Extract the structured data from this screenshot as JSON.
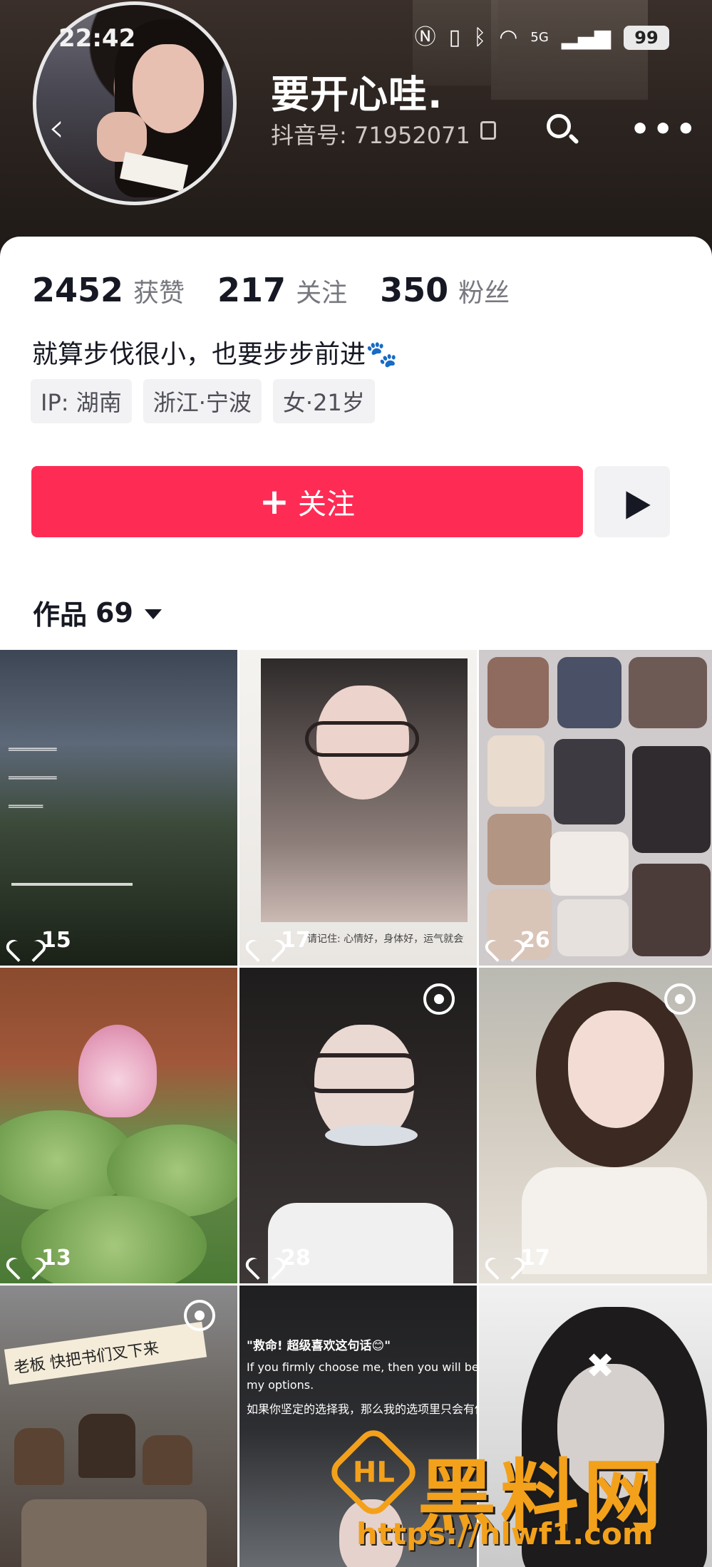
{
  "status_bar": {
    "time": "22:42",
    "battery": "99",
    "network": "5G"
  },
  "profile": {
    "username": "要开心哇.",
    "douyin_id": "抖音号: 71952071",
    "stats": [
      {
        "num": "2452",
        "label": "获赞"
      },
      {
        "num": "217",
        "label": "关注"
      },
      {
        "num": "350",
        "label": "粉丝"
      }
    ],
    "bio": "就算步伐很小，也要步步前进🐾",
    "tags": [
      "IP: 湖南",
      "浙江·宁波",
      "女·21岁"
    ]
  },
  "actions": {
    "follow_label": "关注",
    "follow_plus": "+"
  },
  "works": {
    "label": "作品",
    "count": "69"
  },
  "videos": [
    {
      "likes": "15"
    },
    {
      "likes": "17",
      "note": "请记住: 心情好，身体好，运气就会好"
    },
    {
      "likes": "26"
    },
    {
      "likes": "13"
    },
    {
      "likes": "28"
    },
    {
      "likes": "17"
    },
    {
      "banner": "老板 快把书们叉下来"
    },
    {
      "line1": "\"救命! 超级喜欢这句话😊\"",
      "line2": "If you firmly choose me, then you will be the only one in",
      "line3": "my options.",
      "line4": "如果你坚定的选择我，那么我的选项里只会有你。"
    },
    {}
  ],
  "watermark": {
    "title": "黑料网",
    "url": "https://hlwf1.com",
    "logo_text": "HL"
  },
  "colors": {
    "accent": "#fe2c55",
    "watermark": "#f3a11b"
  }
}
